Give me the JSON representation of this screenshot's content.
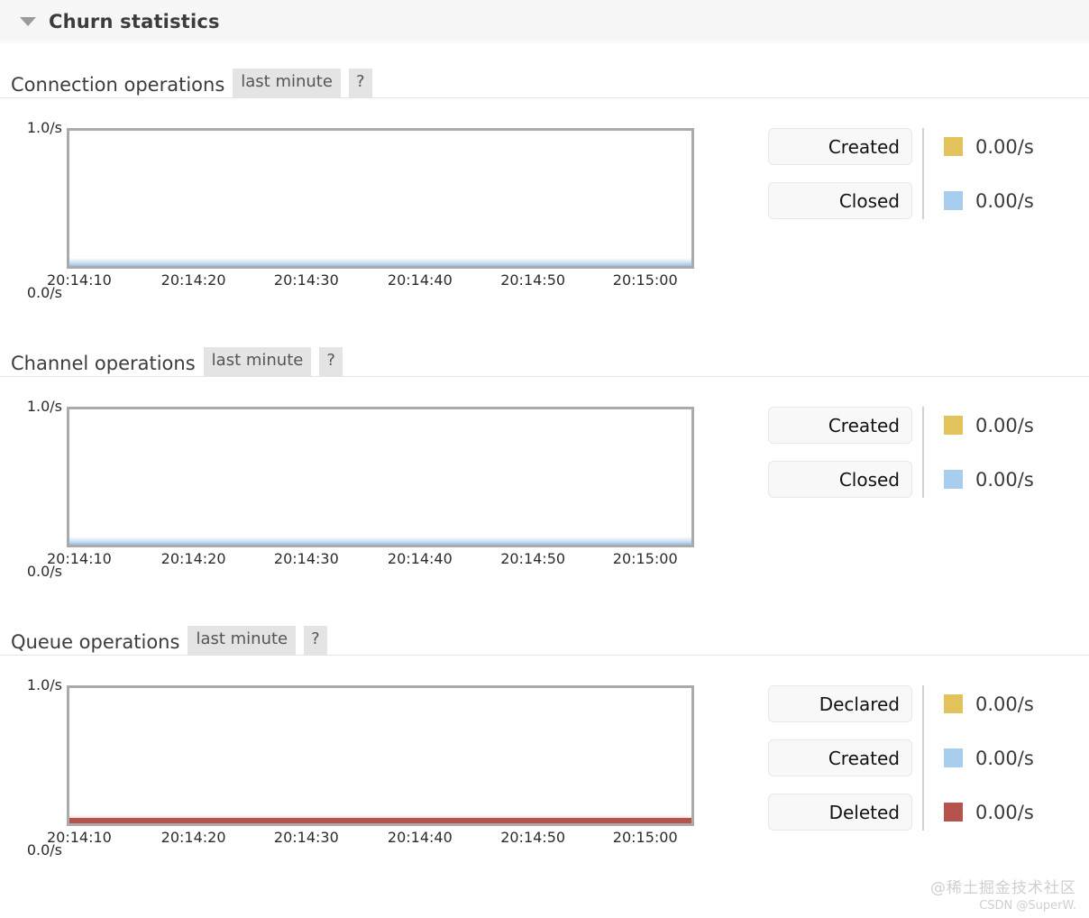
{
  "section": {
    "title": "Churn statistics",
    "caret_icon": "chevron-down-icon",
    "expanded": true
  },
  "colors": {
    "created_gold": "#e2c35b",
    "closed_blue": "#a9cded",
    "deleted_red": "#b5534c",
    "chart_border": "#aaaaaa",
    "badge_bg": "#e4e4e4",
    "header_bg": "#f6f6f6"
  },
  "blocks": [
    {
      "title": "Connection operations",
      "period_badge": "last minute",
      "help_badge": "?",
      "legend": [
        {
          "label": "Created",
          "value": "0.00/s",
          "color": "#e2c35b"
        },
        {
          "label": "Closed",
          "value": "0.00/s",
          "color": "#a9cded"
        }
      ]
    },
    {
      "title": "Channel operations",
      "period_badge": "last minute",
      "help_badge": "?",
      "legend": [
        {
          "label": "Created",
          "value": "0.00/s",
          "color": "#e2c35b"
        },
        {
          "label": "Closed",
          "value": "0.00/s",
          "color": "#a9cded"
        }
      ]
    },
    {
      "title": "Queue operations",
      "period_badge": "last minute",
      "help_badge": "?",
      "legend": [
        {
          "label": "Declared",
          "value": "0.00/s",
          "color": "#e2c35b"
        },
        {
          "label": "Created",
          "value": "0.00/s",
          "color": "#a9cded"
        },
        {
          "label": "Deleted",
          "value": "0.00/s",
          "color": "#b5534c"
        }
      ]
    }
  ],
  "chart_data": [
    {
      "type": "line",
      "title": "Connection operations",
      "subtitle": "last minute",
      "xlabel": "",
      "ylabel": "",
      "x": [
        "20:14:10",
        "20:14:20",
        "20:14:30",
        "20:14:40",
        "20:14:50",
        "20:15:00"
      ],
      "ytick_labels": [
        "0.0/s",
        "1.0/s"
      ],
      "ylim": [
        0,
        1
      ],
      "grid": false,
      "legend_position": "right",
      "series": [
        {
          "name": "Created",
          "color": "#e2c35b",
          "values": [
            0,
            0,
            0,
            0,
            0,
            0
          ],
          "current": "0.00/s"
        },
        {
          "name": "Closed",
          "color": "#a9cded",
          "values": [
            0,
            0,
            0,
            0,
            0,
            0
          ],
          "current": "0.00/s"
        }
      ]
    },
    {
      "type": "line",
      "title": "Channel operations",
      "subtitle": "last minute",
      "xlabel": "",
      "ylabel": "",
      "x": [
        "20:14:10",
        "20:14:20",
        "20:14:30",
        "20:14:40",
        "20:14:50",
        "20:15:00"
      ],
      "ytick_labels": [
        "0.0/s",
        "1.0/s"
      ],
      "ylim": [
        0,
        1
      ],
      "grid": false,
      "legend_position": "right",
      "series": [
        {
          "name": "Created",
          "color": "#e2c35b",
          "values": [
            0,
            0,
            0,
            0,
            0,
            0
          ],
          "current": "0.00/s"
        },
        {
          "name": "Closed",
          "color": "#a9cded",
          "values": [
            0,
            0,
            0,
            0,
            0,
            0
          ],
          "current": "0.00/s"
        }
      ]
    },
    {
      "type": "line",
      "title": "Queue operations",
      "subtitle": "last minute",
      "xlabel": "",
      "ylabel": "",
      "x": [
        "20:14:10",
        "20:14:20",
        "20:14:30",
        "20:14:40",
        "20:14:50",
        "20:15:00"
      ],
      "ytick_labels": [
        "0.0/s",
        "1.0/s"
      ],
      "ylim": [
        0,
        1
      ],
      "grid": false,
      "legend_position": "right",
      "series": [
        {
          "name": "Declared",
          "color": "#e2c35b",
          "values": [
            0,
            0,
            0,
            0,
            0,
            0
          ],
          "current": "0.00/s"
        },
        {
          "name": "Created",
          "color": "#a9cded",
          "values": [
            0,
            0,
            0,
            0,
            0,
            0
          ],
          "current": "0.00/s"
        },
        {
          "name": "Deleted",
          "color": "#b5534c",
          "values": [
            0,
            0,
            0,
            0,
            0,
            0
          ],
          "current": "0.00/s"
        }
      ]
    }
  ],
  "watermark": {
    "main": "@稀土掘金技术社区",
    "sub": "CSDN @SuperW."
  }
}
